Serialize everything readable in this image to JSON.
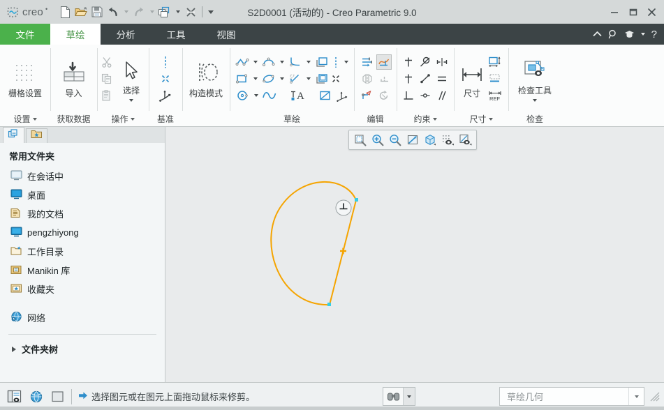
{
  "window": {
    "title": "S2D0001 (活动的) - Creo Parametric 9.0",
    "brand": "creo",
    "minimize_label": "—",
    "maximize_label": "□",
    "close_label": "✕"
  },
  "quick_access": [
    {
      "name": "new-file",
      "label": "新建"
    },
    {
      "name": "open-file",
      "label": "打开"
    },
    {
      "name": "save-file",
      "label": "保存"
    },
    {
      "name": "undo",
      "label": "撤消"
    },
    {
      "name": "undo-dropdown",
      "label": ""
    },
    {
      "name": "redo",
      "label": "重做"
    },
    {
      "name": "redo-dropdown",
      "label": ""
    },
    {
      "name": "window-switch",
      "label": "窗口"
    },
    {
      "name": "window-dropdown",
      "label": ""
    },
    {
      "name": "close-window",
      "label": "关闭"
    },
    {
      "name": "qat-customize",
      "label": ""
    }
  ],
  "ribbon": {
    "tabs": [
      {
        "label": "文件",
        "type": "file",
        "active": false
      },
      {
        "label": "草绘",
        "type": "normal",
        "active": true
      },
      {
        "label": "分析",
        "type": "normal",
        "active": false
      },
      {
        "label": "工具",
        "type": "normal",
        "active": false
      },
      {
        "label": "视图",
        "type": "normal",
        "active": false
      }
    ],
    "right_icons": [
      {
        "name": "collapse-ribbon-icon",
        "glyph": "⌃"
      },
      {
        "name": "search-icon",
        "glyph": "⌕"
      },
      {
        "name": "help-center-icon",
        "glyph": "◓"
      },
      {
        "name": "help-dropdown-icon",
        "glyph": "▾"
      },
      {
        "name": "help-question-icon",
        "glyph": "?"
      }
    ],
    "groups": [
      {
        "name": "settings",
        "label": "设置",
        "has_dropdown": true,
        "big_button": {
          "label": "栅格设置",
          "icon": "grid-settings-icon"
        }
      },
      {
        "name": "get-data",
        "label": "获取数据",
        "has_dropdown": false,
        "big_button": {
          "label": "导入",
          "icon": "import-icon"
        }
      },
      {
        "name": "operations",
        "label": "操作",
        "has_dropdown": true,
        "big_button": {
          "label": "选择",
          "icon": "select-arrow-icon"
        },
        "small_icons": [
          {
            "name": "cut-icon",
            "label": "剪切"
          },
          {
            "name": "copy-icon",
            "label": "复制"
          },
          {
            "name": "paste-icon",
            "label": "粘贴"
          }
        ]
      },
      {
        "name": "datum",
        "label": "基准",
        "has_dropdown": false,
        "small_icons": [
          {
            "name": "centerline-icon",
            "label": "中心线"
          },
          {
            "name": "point-icon",
            "label": "点"
          },
          {
            "name": "coordinate-system-icon",
            "label": "坐标系"
          }
        ]
      },
      {
        "name": "construction-mode",
        "label": "",
        "has_dropdown": false,
        "big_button": {
          "label": "构造模式",
          "icon": "construction-mode-icon"
        }
      },
      {
        "name": "sketching",
        "label": "草绘",
        "has_dropdown": false,
        "small_icons": [
          {
            "name": "line-chain-icon",
            "label": "线链"
          },
          {
            "name": "arc-3point-icon",
            "label": "圆弧"
          },
          {
            "name": "fillet-icon",
            "label": "圆角"
          },
          {
            "name": "offset-icon",
            "label": "偏移"
          },
          {
            "name": "centerline-sketch-icon",
            "label": "中心线"
          },
          {
            "name": "rectangle-icon",
            "label": "矩形"
          },
          {
            "name": "ellipse-icon",
            "label": "椭圆"
          },
          {
            "name": "chamfer-icon",
            "label": "倒角"
          },
          {
            "name": "thicken-icon",
            "label": "加厚"
          },
          {
            "name": "point-sketch-icon",
            "label": "点"
          },
          {
            "name": "circle-icon",
            "label": "圆"
          },
          {
            "name": "spline-icon",
            "label": "样条"
          },
          {
            "name": "text-icon",
            "label": "文本"
          },
          {
            "name": "project-icon",
            "label": "投影"
          },
          {
            "name": "coord-sys-sketch-icon",
            "label": "坐标系"
          }
        ]
      },
      {
        "name": "editing",
        "label": "编辑",
        "has_dropdown": false,
        "small_icons": [
          {
            "name": "modify-icon",
            "label": "修改"
          },
          {
            "name": "trim-icon",
            "label": "删除段",
            "selected": true
          },
          {
            "name": "mirror-icon",
            "label": "镜像"
          },
          {
            "name": "divide-icon",
            "label": "分割"
          },
          {
            "name": "corner-icon",
            "label": "拐角"
          },
          {
            "name": "rotate-resize-icon",
            "label": "旋转调整大小"
          }
        ]
      },
      {
        "name": "constraints",
        "label": "约束",
        "has_dropdown": true,
        "small_icons": [
          {
            "name": "vertical-constraint-icon",
            "label": "竖直"
          },
          {
            "name": "tangent-constraint-icon",
            "label": "相切"
          },
          {
            "name": "symmetric-constraint-icon",
            "label": "对称"
          },
          {
            "name": "horizontal-constraint-icon",
            "label": "水平"
          },
          {
            "name": "midpoint-constraint-icon",
            "label": "中点"
          },
          {
            "name": "equal-constraint-icon",
            "label": "相等"
          },
          {
            "name": "perpendicular-constraint-icon",
            "label": "垂直"
          },
          {
            "name": "coincident-constraint-icon",
            "label": "重合"
          },
          {
            "name": "parallel-constraint-icon",
            "label": "平行"
          }
        ]
      },
      {
        "name": "dimension",
        "label": "尺寸",
        "has_dropdown": true,
        "big_button": {
          "label": "尺寸",
          "icon": "dimension-icon"
        },
        "small_icons": [
          {
            "name": "perimeter-dimension-icon",
            "label": "周长"
          },
          {
            "name": "baseline-dimension-icon",
            "label": "基线"
          },
          {
            "name": "reference-dimension-icon",
            "label": "参考"
          }
        ]
      },
      {
        "name": "inspect",
        "label": "检查",
        "has_dropdown": false,
        "big_button": {
          "label": "检查工具",
          "icon": "inspect-tools-icon",
          "has_dropdown": true
        }
      }
    ]
  },
  "navigator": {
    "tabs": [
      {
        "name": "model-tree-tab",
        "icon": "model-tree-icon",
        "active": true
      },
      {
        "name": "folder-browser-tab",
        "icon": "folder-star-icon",
        "active": false
      }
    ],
    "header": "常用文件夹",
    "items": [
      {
        "label": "在会话中",
        "icon": "in-session-icon"
      },
      {
        "label": "桌面",
        "icon": "desktop-icon"
      },
      {
        "label": "我的文档",
        "icon": "my-documents-icon"
      },
      {
        "label": "pengzhiyong",
        "icon": "user-folder-icon"
      },
      {
        "label": "工作目录",
        "icon": "working-directory-icon"
      },
      {
        "label": "Manikin 库",
        "icon": "manikin-library-icon"
      },
      {
        "label": "收藏夹",
        "icon": "favorites-icon"
      }
    ],
    "network": {
      "label": "网络",
      "icon": "network-icon"
    },
    "folder_tree": {
      "label": "文件夹树",
      "icon": "expand-triangle-icon"
    }
  },
  "view_toolbar": [
    {
      "name": "refit-icon",
      "label": "重新调整"
    },
    {
      "name": "zoom-in-icon",
      "label": "放大"
    },
    {
      "name": "zoom-out-icon",
      "label": "缩小"
    },
    {
      "name": "sketch-view-icon",
      "label": "草绘视图"
    },
    {
      "name": "display-style-icon",
      "label": "显示样式"
    },
    {
      "name": "datum-display-icon",
      "label": "基准显示过滤器"
    },
    {
      "name": "sketcher-display-icon",
      "label": "草绘器显示过滤器"
    }
  ],
  "canvas": {
    "colors": {
      "sketch_entity": "#f5a400",
      "endpoint": "#33cfe8",
      "background": "#e9ebec"
    },
    "constraint_badge": {
      "name": "perpendicular-constraint-badge",
      "glyph": "⊥"
    },
    "entities": [
      {
        "type": "arc",
        "name": "sketch-arc"
      },
      {
        "type": "line",
        "name": "sketch-line"
      },
      {
        "type": "midpoint-marker",
        "name": "sketch-midpoint-marker"
      }
    ]
  },
  "statusbar": {
    "left_buttons": [
      {
        "name": "navigator-toggle-icon",
        "label": "显示导航器"
      },
      {
        "name": "web-browser-icon",
        "label": "Web 浏览器"
      },
      {
        "name": "full-screen-icon",
        "label": "全屏"
      }
    ],
    "message_arrow": "➡",
    "message": "选择图元或在图元上面拖动鼠标来修剪。",
    "find_button": {
      "name": "find-icon",
      "label": "查找"
    },
    "filter": {
      "value": "草绘几何",
      "dropdown_glyph": "▾"
    }
  }
}
